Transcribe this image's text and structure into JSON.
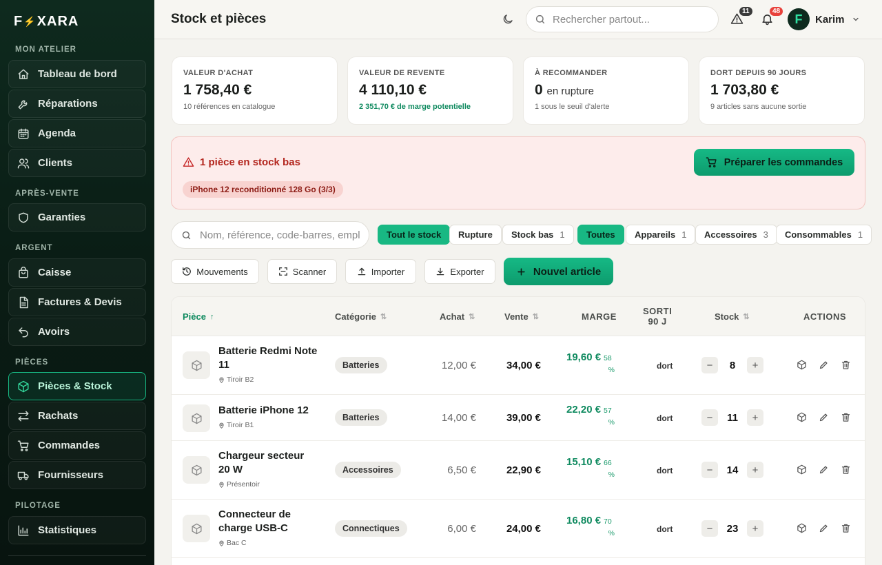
{
  "brand": {
    "logo_left": "F",
    "logo_bolt": "⚡",
    "logo_right": "XARA"
  },
  "sidebar": {
    "sections": [
      {
        "title": "MON ATELIER",
        "items": [
          {
            "label": "Tableau de bord"
          },
          {
            "label": "Réparations"
          },
          {
            "label": "Agenda"
          },
          {
            "label": "Clients"
          }
        ]
      },
      {
        "title": "APRÈS-VENTE",
        "items": [
          {
            "label": "Garanties"
          }
        ]
      },
      {
        "title": "ARGENT",
        "items": [
          {
            "label": "Caisse"
          },
          {
            "label": "Factures & Devis"
          },
          {
            "label": "Avoirs"
          }
        ]
      },
      {
        "title": "PIÈCES",
        "items": [
          {
            "label": "Pièces & Stock"
          },
          {
            "label": "Rachats"
          },
          {
            "label": "Commandes"
          },
          {
            "label": "Fournisseurs"
          }
        ]
      },
      {
        "title": "PILOTAGE",
        "items": [
          {
            "label": "Statistiques"
          }
        ]
      }
    ],
    "active_item": "Pièces & Stock"
  },
  "header": {
    "title": "Stock et pièces",
    "search_placeholder": "Rechercher partout...",
    "alerts_count": "11",
    "notifications_count": "48",
    "user_initial": "F",
    "user_name": "Karim"
  },
  "kpis": [
    {
      "label": "VALEUR D'ACHAT",
      "value": "1 758,40 €",
      "suffix": "",
      "sub": "10 références en catalogue"
    },
    {
      "label": "VALEUR DE REVENTE",
      "value": "4 110,10 €",
      "suffix": "",
      "sub": "2 351,70 € de marge potentielle"
    },
    {
      "label": "À RECOMMANDER",
      "value": "0",
      "suffix": "en rupture",
      "sub": "1 sous le seuil d'alerte"
    },
    {
      "label": "DORT DEPUIS 90 JOURS",
      "value": "1 703,80 €",
      "suffix": "",
      "sub": "9 articles sans aucune sortie"
    }
  ],
  "low_stock_alert": {
    "title": "1 pièce en stock bas",
    "item": "iPhone 12 reconditionné 128 Go (3/3)",
    "action": "Préparer les commandes"
  },
  "filters": {
    "search_placeholder": "Nom, référence, code-barres, emplacement",
    "stock_chips": [
      {
        "label": "Tout le stock",
        "count": ""
      },
      {
        "label": "Rupture",
        "count": ""
      },
      {
        "label": "Stock bas",
        "count": "1"
      }
    ],
    "category_chips": [
      {
        "label": "Toutes",
        "count": ""
      },
      {
        "label": "Appareils",
        "count": "1"
      },
      {
        "label": "Accessoires",
        "count": "3"
      },
      {
        "label": "Consommables",
        "count": "1"
      }
    ]
  },
  "actions": {
    "movements": "Mouvements",
    "scan": "Scanner",
    "import": "Importer",
    "export": "Exporter",
    "new_item": "Nouvel article"
  },
  "table": {
    "columns": {
      "piece": "Pièce",
      "category": "Catégorie",
      "buy": "Achat",
      "sell": "Vente",
      "margin": "MARGE",
      "out_line1": "SORTI",
      "out_line2": "90 J",
      "stock": "Stock",
      "actions": "ACTIONS"
    },
    "rows": [
      {
        "name": "Batterie Redmi Note 11",
        "location": "Tiroir B2",
        "category": "Batteries",
        "buy": "12,00 €",
        "sell": "34,00 €",
        "margin": "19,60 €",
        "margin_pct_a": "58",
        "margin_pct_b": "%",
        "out": "dort",
        "stock": "8"
      },
      {
        "name": "Batterie iPhone 12",
        "location": "Tiroir B1",
        "category": "Batteries",
        "buy": "14,00 €",
        "sell": "39,00 €",
        "margin": "22,20 €",
        "margin_pct_a": "57",
        "margin_pct_b": "%",
        "out": "dort",
        "stock": "11"
      },
      {
        "name": "Chargeur secteur 20 W",
        "location": "Présentoir",
        "category": "Accessoires",
        "buy": "6,50 €",
        "sell": "22,90 €",
        "margin": "15,10 €",
        "margin_pct_a": "66",
        "margin_pct_b": "%",
        "out": "dort",
        "stock": "14"
      },
      {
        "name": "Connecteur de charge USB-C",
        "location": "Bac C",
        "category": "Connectiques",
        "buy": "6,00 €",
        "sell": "24,00 €",
        "margin": "16,80 €",
        "margin_pct_a": "70",
        "margin_pct_b": "%",
        "out": "dort",
        "stock": "23"
      }
    ],
    "stepper_minus": "−",
    "stepper_plus": "+"
  },
  "colors": {
    "accent": "#18b883",
    "sidebar_bg": "#0e2a1e",
    "alert_red": "#b3261e",
    "margin_green": "#0f8a5f"
  }
}
